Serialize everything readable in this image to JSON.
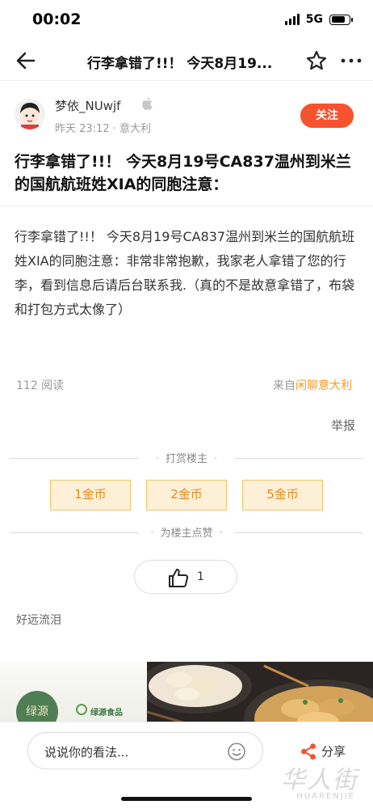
{
  "status": {
    "time": "00:02",
    "network": "5G"
  },
  "nav": {
    "title": "行李拿错了!!！ 今天8月19..."
  },
  "author": {
    "name": "梦依_NUwjf",
    "meta": "昨天 23:12 · 意大利",
    "follow_label": "关注"
  },
  "post": {
    "title": "行李拿错了!!！ 今天8月19号CA837温州到米兰的国航航班姓XIA的同胞注意：",
    "body": "行李拿错了!!！ 今天8月19号CA837温州到米兰的国航航班姓XIA的同胞注意：非常非常抱歉，我家老人拿错了您的行李，看到信息后请后台联系我.（真的不是故意拿错了，布袋和打包方式太像了）",
    "read_count": "112 阅读",
    "source_prefix": "来自",
    "source_forum": "闲聊意大利",
    "report_label": "举报"
  },
  "reward": {
    "section_label": "打赏楼主",
    "coins": [
      "1金币",
      "2金币",
      "5金币"
    ]
  },
  "like": {
    "section_label": "为楼主点赞",
    "count": "1",
    "liker": "好远流泪"
  },
  "ad": {
    "brand": "绿源食品",
    "logo_text": "绿源"
  },
  "bottom": {
    "comment_placeholder": "说说你的看法...",
    "share_label": "分享"
  },
  "watermark": {
    "main": "华人街",
    "sub": "HUARENJIE"
  }
}
